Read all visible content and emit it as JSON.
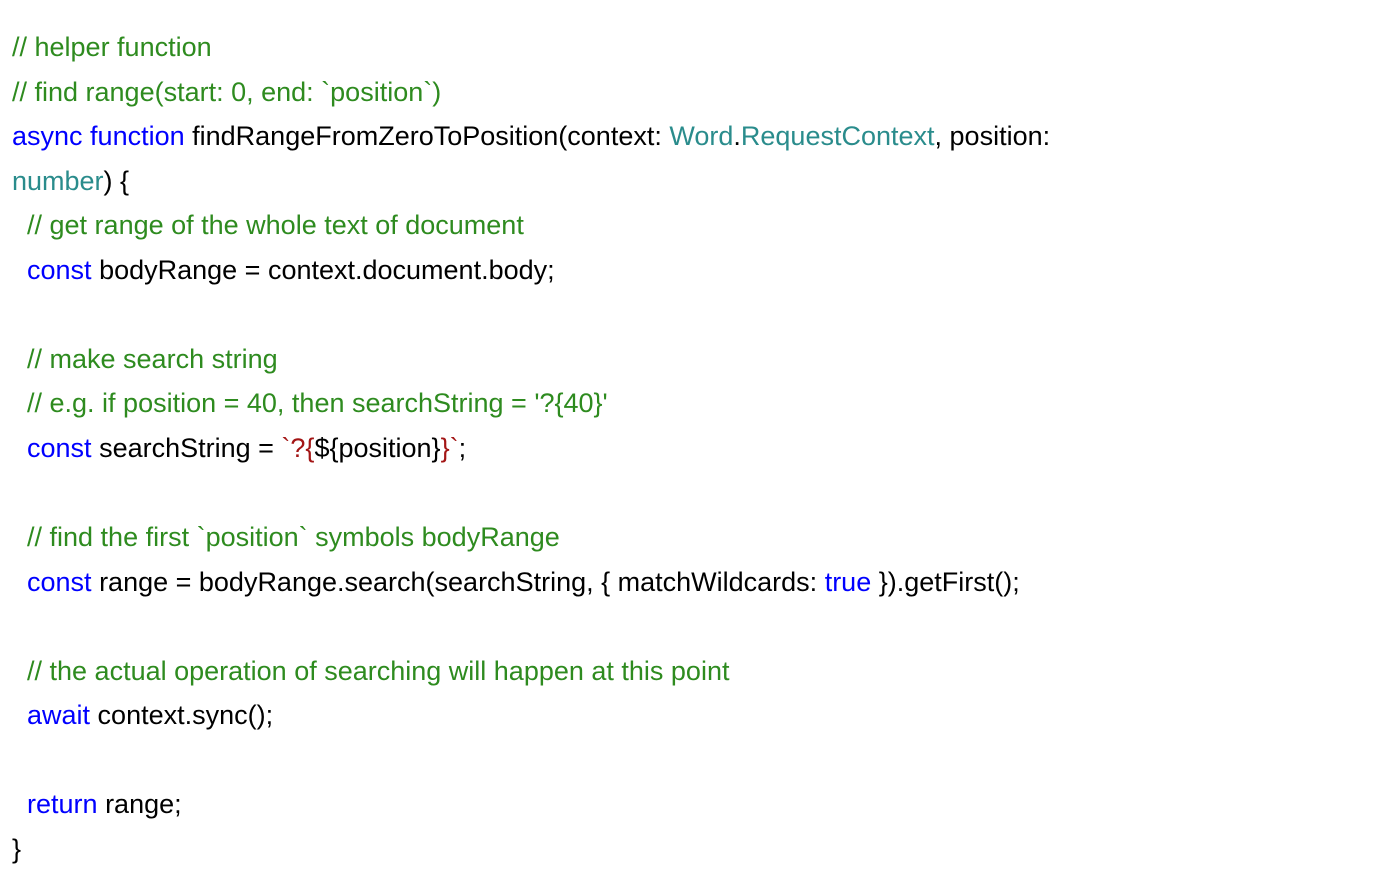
{
  "code": {
    "line1": {
      "comment": "// helper function"
    },
    "line2": {
      "comment": "// find range(start: 0, end: `position`)"
    },
    "line3": {
      "kw_async": "async ",
      "kw_function": "function",
      "fn_name": " findRangeFromZeroToPosition(context: ",
      "type1": "Word",
      "dot": ".",
      "type2": "RequestContext",
      "after_type": ", position: "
    },
    "line4": {
      "type_number": "number",
      "after": ") {"
    },
    "line5": {
      "indent": "  ",
      "comment": "// get range of the whole text of document"
    },
    "line6": {
      "indent": "  ",
      "kw_const": "const",
      "text": " bodyRange = context.document.body;"
    },
    "line7": {
      "blank": ""
    },
    "line8": {
      "indent": "  ",
      "comment": "// make search string"
    },
    "line9": {
      "indent": "  ",
      "comment": "// e.g. if position = 40, then searchString = '?{40}'"
    },
    "line10": {
      "indent": "  ",
      "kw_const": "const",
      "text1": " searchString = ",
      "str1": "`?{",
      "interp": "${position}",
      "str2": "}`",
      "semicolon": ";"
    },
    "line11": {
      "blank": ""
    },
    "line12": {
      "indent": "  ",
      "comment": "// find the first `position` symbols bodyRange"
    },
    "line13": {
      "indent": "  ",
      "kw_const": "const",
      "text1": " range = bodyRange.search(searchString, { matchWildcards: ",
      "kw_true": "true",
      "text2": " }).getFirst();"
    },
    "line14": {
      "blank": ""
    },
    "line15": {
      "indent": "  ",
      "comment": "// the actual operation of searching will happen at this point"
    },
    "line16": {
      "indent": "  ",
      "kw_await": "await",
      "text": " context.sync();"
    },
    "line17": {
      "blank": ""
    },
    "line18": {
      "indent": "  ",
      "kw_return": "return",
      "text": " range;"
    },
    "line19": {
      "text": "}"
    }
  }
}
